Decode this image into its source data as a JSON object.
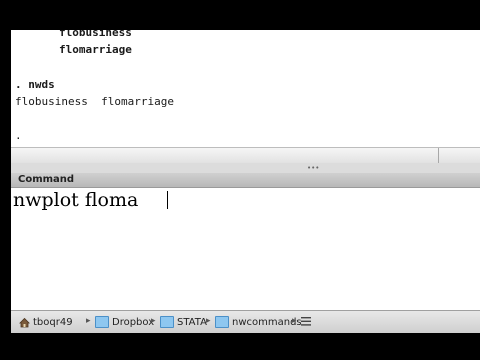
{
  "results": {
    "lines": [
      {
        "text": "flobusiness",
        "bold": true
      },
      {
        "text": "flomarriage",
        "bold": true
      },
      {
        "text": ". nwds",
        "bold": true
      },
      {
        "text": "flobusiness  flomarriage",
        "bold": false
      },
      {
        "text": ".",
        "bold": false
      }
    ]
  },
  "command": {
    "header": "Command",
    "value": "nwplot floma"
  },
  "statusbar": {
    "path": [
      "tboqr49",
      "Dropbox",
      "STATA",
      "nwcommands"
    ],
    "separator": "▸"
  }
}
